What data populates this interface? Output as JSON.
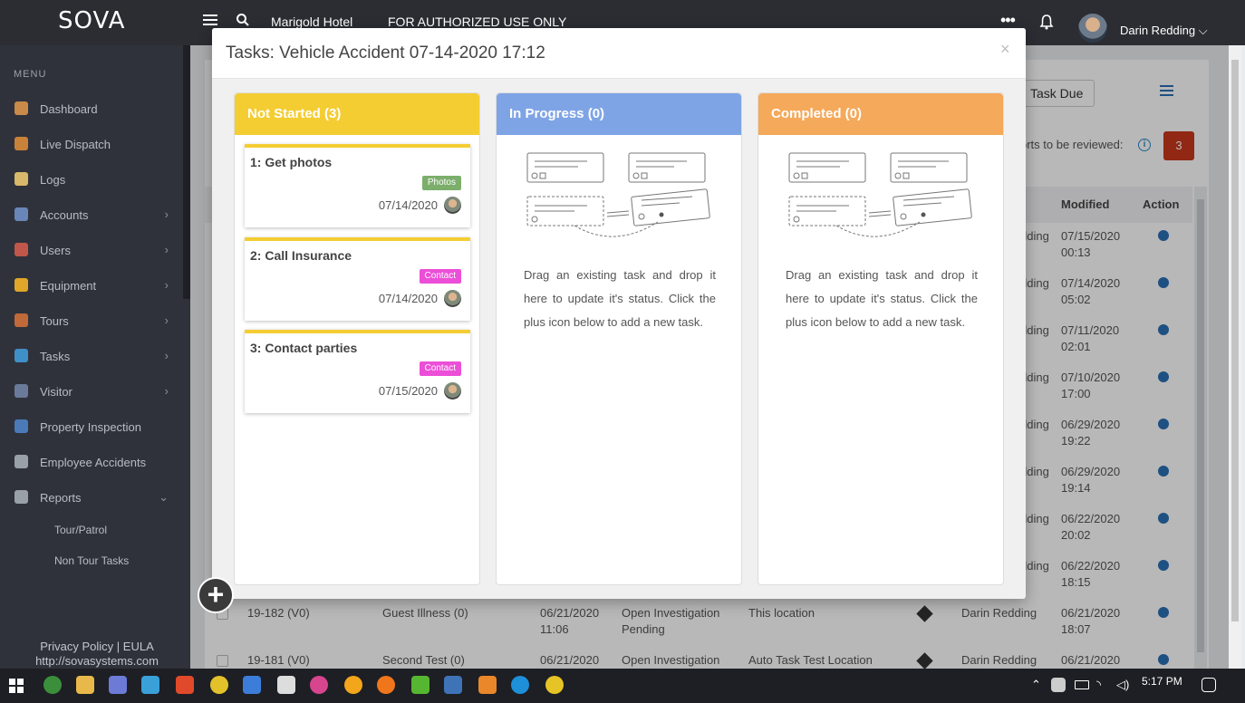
{
  "topbar": {
    "logo": "SOVA",
    "hotel": "Marigold Hotel",
    "banner": "FOR AUTHORIZED USE ONLY",
    "more_icon": "•••",
    "user_name": "Darin Redding ⌵"
  },
  "sidebar": {
    "menu_heading": "MENU",
    "items": [
      {
        "label": "Dashboard",
        "icon": "home-icon",
        "chevron": ""
      },
      {
        "label": "Live Dispatch",
        "icon": "shield-icon",
        "chevron": ""
      },
      {
        "label": "Logs",
        "icon": "pencil-icon",
        "chevron": ""
      },
      {
        "label": "Accounts",
        "icon": "building-icon",
        "chevron": "›"
      },
      {
        "label": "Users",
        "icon": "user-icon",
        "chevron": "›"
      },
      {
        "label": "Equipment",
        "icon": "helmet-icon",
        "chevron": "›"
      },
      {
        "label": "Tours",
        "icon": "compass-icon",
        "chevron": "›"
      },
      {
        "label": "Tasks",
        "icon": "sun-icon",
        "chevron": "›"
      },
      {
        "label": "Visitor",
        "icon": "visitor-icon",
        "chevron": "›"
      },
      {
        "label": "Property Inspection",
        "icon": "globe-icon",
        "chevron": ""
      },
      {
        "label": "Employee Accidents",
        "icon": "clipboard-icon",
        "chevron": ""
      },
      {
        "label": "Reports",
        "icon": "clipboard-icon",
        "chevron": "⌄"
      }
    ],
    "subitems": [
      "Tour/Patrol",
      "Non Tour Tasks"
    ],
    "privacy": "Privacy Policy | EULA",
    "site": "http://sovasystems.com"
  },
  "background": {
    "task_due": "Task Due",
    "reviewed_text": "orts to be reviewed:",
    "info_icon": "i",
    "reviewed_count": "3",
    "headers": {
      "modified": "Modified",
      "action": "Action"
    },
    "modified_rows": [
      {
        "name": "dding",
        "date": "07/15/2020",
        "time": "00:13"
      },
      {
        "name": "dding",
        "date": "07/14/2020",
        "time": "05:02"
      },
      {
        "name": "dding",
        "date": "07/11/2020",
        "time": "02:01"
      },
      {
        "name": "dding",
        "date": "07/10/2020",
        "time": "17:00"
      },
      {
        "name": "dding",
        "date": "06/29/2020",
        "time": "19:22"
      },
      {
        "name": "dding",
        "date": "06/29/2020",
        "time": "19:14"
      },
      {
        "name": "dding",
        "date": "06/22/2020",
        "time": "20:02"
      },
      {
        "name": "dding",
        "date": "06/22/2020",
        "time": "18:15"
      }
    ],
    "full_rows": [
      {
        "id": "19-182 (V0)",
        "type": "Guest Illness (0)",
        "created_date": "06/21/2020",
        "created_time": "11:06",
        "status": "Open Investigation",
        "status2": "Pending",
        "location": "This location",
        "user": "Darin Redding",
        "modified_date": "06/21/2020",
        "modified_time": "18:07"
      },
      {
        "id": "19-181 (V0)",
        "type": "Second Test (0)",
        "created_date": "06/21/2020",
        "created_time": "",
        "status": "Open Investigation",
        "status2": "",
        "location": "Auto Task Test Location",
        "user": "Darin Redding",
        "modified_date": "06/21/2020",
        "modified_time": ""
      }
    ]
  },
  "modal": {
    "title": "Tasks: Vehicle Accident 07-14-2020 17:12",
    "close": "×",
    "columns": [
      {
        "title": "Not Started (3)",
        "color": "#f4cd33"
      },
      {
        "title": "In Progress (0)",
        "color": "#7fa4e6"
      },
      {
        "title": "Completed (0)",
        "color": "#f5a95a"
      }
    ],
    "cards": [
      {
        "title": "1: Get photos",
        "tag": "Photos",
        "tag_color": "#7cae6c",
        "date": "07/14/2020"
      },
      {
        "title": "2: Call Insurance",
        "tag": "Contact",
        "tag_color": "#ec4fd7",
        "date": "07/14/2020"
      },
      {
        "title": "3: Contact parties",
        "tag": "Contact",
        "tag_color": "#ec4fd7",
        "date": "07/15/2020"
      }
    ],
    "empty_text": "Drag an existing task and drop it here to update it's status. Click the plus icon below to add a new task.",
    "add_button": "+"
  },
  "taskbar": {
    "time": "5:17 PM"
  }
}
